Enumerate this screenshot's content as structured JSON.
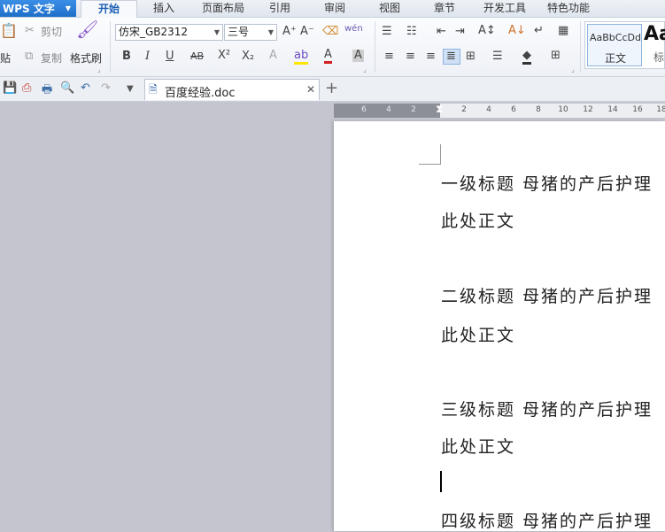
{
  "menu": {
    "app_name": "WPS 文字",
    "tabs": [
      "开始",
      "插入",
      "页面布局",
      "引用",
      "审阅",
      "视图",
      "章节",
      "开发工具",
      "特色功能"
    ],
    "active_tab": "开始"
  },
  "ribbon": {
    "paste_label": "贴",
    "cut_label": "剪切",
    "copy_label": "复制",
    "format_painter_label": "格式刷",
    "font_name": "仿宋_GB2312",
    "font_size": "三号",
    "style_normal_preview": "AaBbCcDd",
    "style_normal_name": "正文",
    "style_heading_preview": "Aa",
    "style_heading_name": "标"
  },
  "document": {
    "tab_title": "百度经验.doc"
  },
  "ruler": {
    "left_ticks": [
      "6",
      "4",
      "2"
    ],
    "right_ticks": [
      "2",
      "4",
      "6",
      "8",
      "10",
      "12",
      "14",
      "16",
      "18"
    ]
  },
  "page": {
    "paragraphs": [
      "一级标题 母猪的产后护理",
      "此处正文",
      "二级标题 母猪的产后护理",
      "此处正文",
      "三级标题 母猪的产后护理",
      "此处正文",
      "四级标题 母猪的产后护理"
    ]
  }
}
